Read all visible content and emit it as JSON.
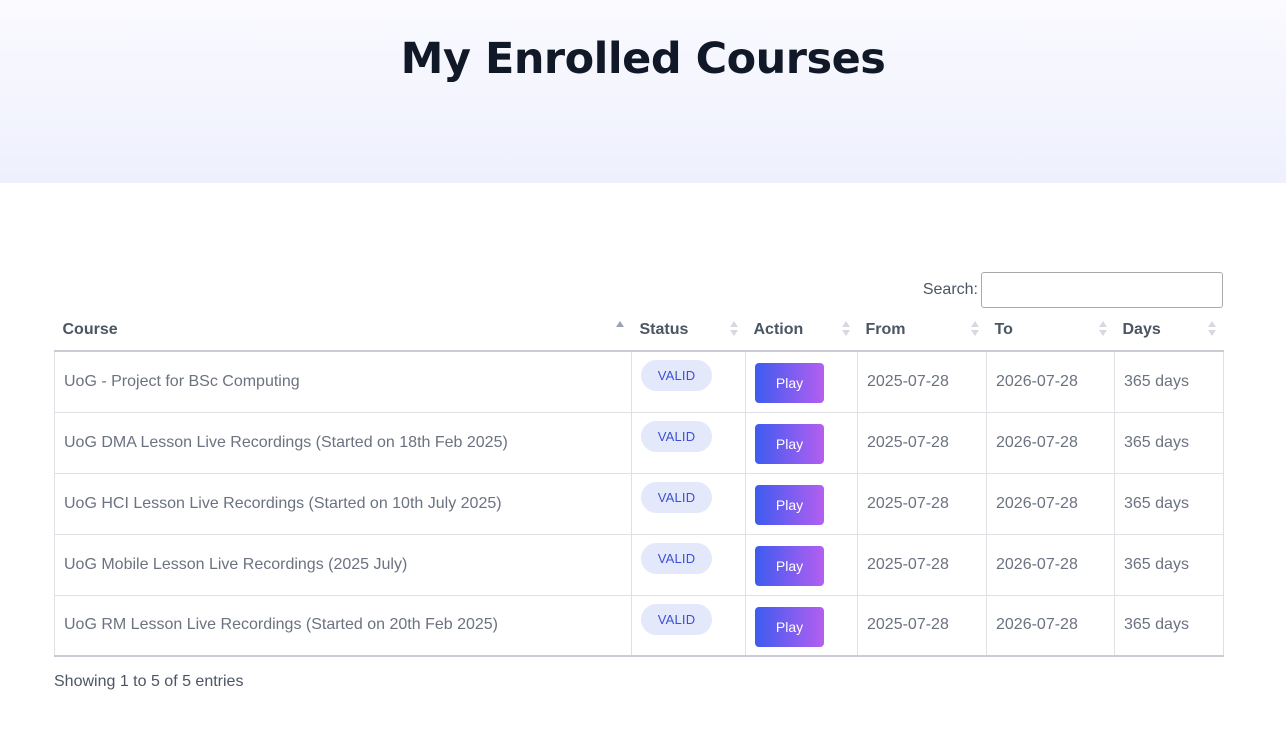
{
  "page": {
    "title": "My Enrolled Courses"
  },
  "search": {
    "label": "Search:",
    "value": "",
    "placeholder": ""
  },
  "table": {
    "columns": [
      "Course",
      "Status",
      "Action",
      "From",
      "To",
      "Days"
    ],
    "rows": [
      {
        "course": "UoG - Project for BSc Computing",
        "status": "VALID",
        "action": "Play",
        "from": "2025-07-28",
        "to": "2026-07-28",
        "days": "365 days"
      },
      {
        "course": "UoG DMA Lesson Live Recordings (Started on 18th Feb 2025)",
        "status": "VALID",
        "action": "Play",
        "from": "2025-07-28",
        "to": "2026-07-28",
        "days": "365 days"
      },
      {
        "course": "UoG HCI Lesson Live Recordings (Started on 10th July 2025)",
        "status": "VALID",
        "action": "Play",
        "from": "2025-07-28",
        "to": "2026-07-28",
        "days": "365 days"
      },
      {
        "course": "UoG Mobile Lesson Live Recordings (2025 July)",
        "status": "VALID",
        "action": "Play",
        "from": "2025-07-28",
        "to": "2026-07-28",
        "days": "365 days"
      },
      {
        "course": "UoG RM Lesson Live Recordings (Started on 20th Feb 2025)",
        "status": "VALID",
        "action": "Play",
        "from": "2025-07-28",
        "to": "2026-07-28",
        "days": "365 days"
      }
    ]
  },
  "footer": {
    "info": "Showing 1 to 5 of 5 entries"
  },
  "colors": {
    "title": "#111827",
    "badge_bg": "#e3e8fb",
    "badge_text": "#3d4fd6",
    "button_start": "#3d5bf0",
    "button_end": "#b45ff0"
  },
  "icons": {
    "sort": "sort-arrows-icon",
    "sort_active": "sort-ascending-icon"
  }
}
